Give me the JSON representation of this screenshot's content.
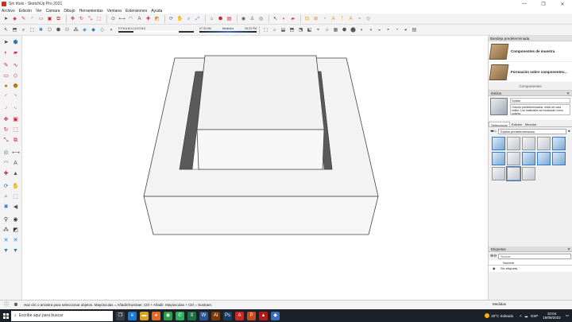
{
  "window": {
    "title": "Sin título - SketchUp Pro 2021",
    "controls": [
      "—",
      "❐",
      "✕"
    ]
  },
  "menu": [
    "Archivo",
    "Edición",
    "Ver",
    "Cámara",
    "Dibujo",
    "Herramientas",
    "Ventana",
    "Extensiones",
    "Ayuda"
  ],
  "shadows": {
    "months": [
      "E",
      "F",
      "M",
      "A",
      "M",
      "J",
      "J",
      "A",
      "S",
      "O",
      "N",
      "D"
    ],
    "time_start": "07:33 AM",
    "time_mid": "Mediodía",
    "time_end": "06:33 PM"
  },
  "tray": {
    "title": "Bandeja predeterminada",
    "components": [
      {
        "name": "Componentes de muestra"
      },
      {
        "name": "Formación sobre componentes..."
      }
    ],
    "components_label": "Componentes",
    "styles": {
      "header": "Estilos",
      "style_name": "Sólido",
      "description": "Colores predeterminados, estilo de cara sólido. Los materiales se mostrarán como colores",
      "tabs": [
        "Seleccionar",
        "Edición",
        "Mezclar"
      ],
      "collection": "Estilos predeterminados"
    },
    "tags": {
      "header": "Etiquetas",
      "search_placeholder": "Buscar",
      "column_name": "Nombre",
      "rows": [
        "Sin etiqueta"
      ]
    }
  },
  "status": {
    "message": "Haz clic o arrastra para seleccionar objetos. Mayúsculas = Añadir/Sustraer. Ctrl + Añadir. Mayúsculas + Ctrl = Sustraer.",
    "measure_label": "Medidas"
  },
  "taskbar": {
    "search_placeholder": "Escribe aquí para buscar",
    "weather": "20°C  Soleado",
    "lang": "ESP",
    "time": "10:04",
    "date": "19/09/2022"
  }
}
